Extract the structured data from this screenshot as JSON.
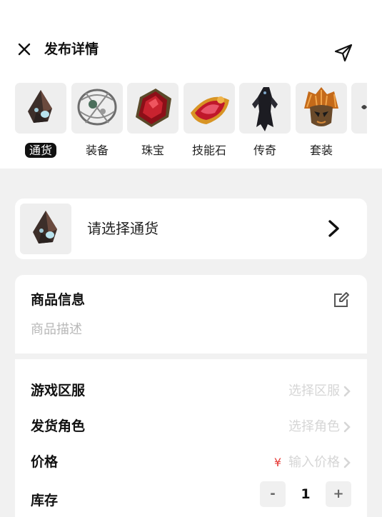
{
  "header": {
    "title": "发布详情"
  },
  "categories": [
    {
      "label": "通货",
      "icon": "currency-shard-icon",
      "active": true
    },
    {
      "label": "装备",
      "icon": "equipment-icon"
    },
    {
      "label": "珠宝",
      "icon": "jewel-icon"
    },
    {
      "label": "技能石",
      "icon": "skill-gem-icon"
    },
    {
      "label": "传奇",
      "icon": "legendary-icon"
    },
    {
      "label": "套装",
      "icon": "set-icon"
    }
  ],
  "selector": {
    "text": "请选择通货"
  },
  "product_info": {
    "heading": "商品信息",
    "description_placeholder": "商品描述"
  },
  "form": {
    "server": {
      "label": "游戏区服",
      "placeholder": "选择区服"
    },
    "role": {
      "label": "发货角色",
      "placeholder": "选择角色"
    },
    "price": {
      "label": "价格",
      "currency_symbol": "¥",
      "placeholder": "输入价格"
    },
    "stock": {
      "label": "库存",
      "value": "1",
      "minus": "-",
      "plus": "+"
    }
  }
}
